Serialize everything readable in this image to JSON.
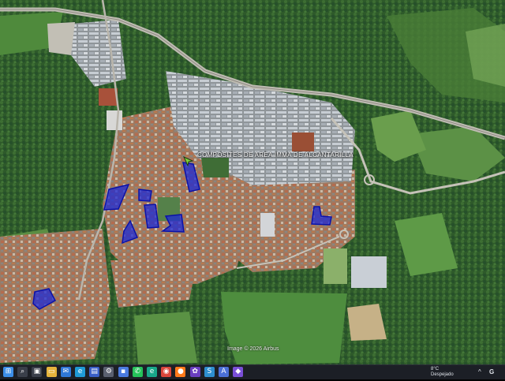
{
  "map": {
    "place_label": "COMPOSITES DE AREA IMMA DE ALCANTARILLA",
    "attribution": "Image © 2026 Airbus",
    "highlight_color": "#1d2bd6",
    "highlight_stroke": "#0a12a8"
  },
  "taskbar": {
    "icons": [
      {
        "name": "windows-start-icon",
        "glyph": "⊞",
        "color": "#3c8ee8"
      },
      {
        "name": "search-icon",
        "glyph": "⌕",
        "color": "#3a3f4a"
      },
      {
        "name": "task-view-icon",
        "glyph": "▣",
        "color": "#3a3f4a"
      },
      {
        "name": "file-explorer-icon",
        "glyph": "▭",
        "color": "#e6b43c"
      },
      {
        "name": "mail-icon",
        "glyph": "✉",
        "color": "#2f78d8"
      },
      {
        "name": "edge-browser-icon",
        "glyph": "e",
        "color": "#1f9ad6"
      },
      {
        "name": "store-icon",
        "glyph": "▤",
        "color": "#3a5fc8"
      },
      {
        "name": "settings-icon",
        "glyph": "⚙",
        "color": "#5a6070"
      },
      {
        "name": "save-icon",
        "glyph": "▪",
        "color": "#4a7be0"
      },
      {
        "name": "whatsapp-icon",
        "glyph": "✆",
        "color": "#25c25a"
      },
      {
        "name": "edge-alt-icon",
        "glyph": "e",
        "color": "#18a88a"
      },
      {
        "name": "chrome-icon",
        "glyph": "◉",
        "color": "#d9463b"
      },
      {
        "name": "firefox-icon",
        "glyph": "●",
        "color": "#ff7a1a"
      },
      {
        "name": "maps-app-icon",
        "glyph": "✿",
        "color": "#6a3fc0"
      },
      {
        "name": "swiftkey-icon",
        "glyph": "S",
        "color": "#2e8fd0"
      },
      {
        "name": "text-app-icon",
        "glyph": "A",
        "color": "#4b6fd6"
      },
      {
        "name": "sound-app-icon",
        "glyph": "◆",
        "color": "#7a4fd8"
      }
    ],
    "weather_temp": "8°C",
    "weather_desc": "Despejado",
    "tray_caret": "^",
    "tray_text": "G"
  }
}
